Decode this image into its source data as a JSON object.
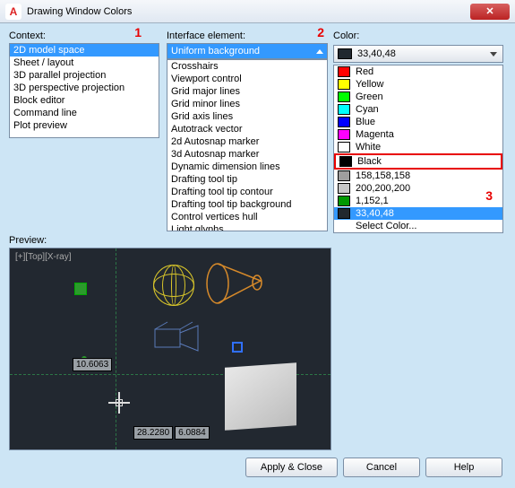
{
  "title": "Drawing Window Colors",
  "callouts": {
    "one": "1",
    "two": "2",
    "three": "3"
  },
  "labels": {
    "context": "Context:",
    "interface": "Interface element:",
    "color": "Color:",
    "preview": "Preview:"
  },
  "context": {
    "selected": "2D model space",
    "items": [
      "2D model space",
      "Sheet / layout",
      "3D parallel projection",
      "3D perspective projection",
      "Block editor",
      "Command line",
      "Plot preview"
    ]
  },
  "iface": {
    "selected": "Uniform background",
    "items": [
      "Uniform background",
      "Crosshairs",
      "Viewport control",
      "Grid major lines",
      "Grid minor lines",
      "Grid axis lines",
      "Autotrack vector",
      "2d Autosnap marker",
      "3d Autosnap marker",
      "Dynamic dimension lines",
      "Drafting tool tip",
      "Drafting tool tip contour",
      "Drafting tool tip background",
      "Control vertices hull",
      "Light glyphs"
    ]
  },
  "color": {
    "selected_label": "33,40,48",
    "selected_hex": "#21282f",
    "items": [
      {
        "label": "Red",
        "hex": "#ff0000"
      },
      {
        "label": "Yellow",
        "hex": "#ffff00"
      },
      {
        "label": "Green",
        "hex": "#00ff00"
      },
      {
        "label": "Cyan",
        "hex": "#00ffff"
      },
      {
        "label": "Blue",
        "hex": "#0000ff"
      },
      {
        "label": "Magenta",
        "hex": "#ff00ff"
      },
      {
        "label": "White",
        "hex": "#ffffff"
      },
      {
        "label": "Black",
        "hex": "#000000"
      },
      {
        "label": "158,158,158",
        "hex": "#9e9e9e"
      },
      {
        "label": "200,200,200",
        "hex": "#c8c8c8"
      },
      {
        "label": "1,152,1",
        "hex": "#019801"
      },
      {
        "label": "33,40,48",
        "hex": "#21282f"
      },
      {
        "label": "Select Color...",
        "hex": null
      }
    ],
    "highlighted_index": 11,
    "red_highlight_index": 7
  },
  "preview": {
    "viewport_label": "[+][Top][X-ray]",
    "coord1": "10.6063",
    "coord2a": "28.2280",
    "coord2b": "6.0884"
  },
  "buttons": {
    "apply_close": "Apply & Close",
    "cancel": "Cancel",
    "help": "Help"
  }
}
